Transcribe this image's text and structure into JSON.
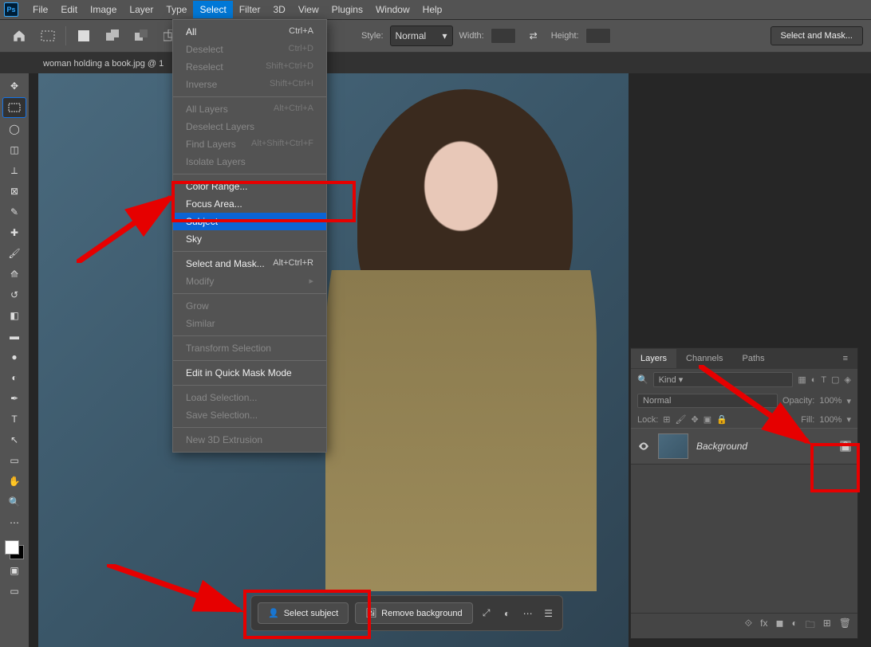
{
  "menubar": [
    "File",
    "Edit",
    "Image",
    "Layer",
    "Type",
    "Select",
    "Filter",
    "3D",
    "View",
    "Plugins",
    "Window",
    "Help"
  ],
  "active_menu": "Select",
  "tab": "woman holding a book.jpg @ 1",
  "optbar": {
    "style_label": "Style:",
    "style_value": "Normal",
    "width_label": "Width:",
    "height_label": "Height:",
    "mask_btn": "Select and Mask..."
  },
  "dropdown": {
    "groups": [
      [
        {
          "label": "All",
          "shortcut": "Ctrl+A",
          "enabled": true
        },
        {
          "label": "Deselect",
          "shortcut": "Ctrl+D",
          "enabled": false
        },
        {
          "label": "Reselect",
          "shortcut": "Shift+Ctrl+D",
          "enabled": false
        },
        {
          "label": "Inverse",
          "shortcut": "Shift+Ctrl+I",
          "enabled": false
        }
      ],
      [
        {
          "label": "All Layers",
          "shortcut": "Alt+Ctrl+A",
          "enabled": false
        },
        {
          "label": "Deselect Layers",
          "shortcut": "",
          "enabled": false
        },
        {
          "label": "Find Layers",
          "shortcut": "Alt+Shift+Ctrl+F",
          "enabled": false
        },
        {
          "label": "Isolate Layers",
          "shortcut": "",
          "enabled": false
        }
      ],
      [
        {
          "label": "Color Range...",
          "shortcut": "",
          "enabled": true
        },
        {
          "label": "Focus Area...",
          "shortcut": "",
          "enabled": true
        },
        {
          "label": "Subject",
          "shortcut": "",
          "enabled": true,
          "highlight": true
        },
        {
          "label": "Sky",
          "shortcut": "",
          "enabled": true
        }
      ],
      [
        {
          "label": "Select and Mask...",
          "shortcut": "Alt+Ctrl+R",
          "enabled": true
        },
        {
          "label": "Modify",
          "shortcut": "",
          "enabled": false,
          "submenu": true
        }
      ],
      [
        {
          "label": "Grow",
          "shortcut": "",
          "enabled": false
        },
        {
          "label": "Similar",
          "shortcut": "",
          "enabled": false
        }
      ],
      [
        {
          "label": "Transform Selection",
          "shortcut": "",
          "enabled": false
        }
      ],
      [
        {
          "label": "Edit in Quick Mask Mode",
          "shortcut": "",
          "enabled": true
        }
      ],
      [
        {
          "label": "Load Selection...",
          "shortcut": "",
          "enabled": false
        },
        {
          "label": "Save Selection...",
          "shortcut": "",
          "enabled": false
        }
      ],
      [
        {
          "label": "New 3D Extrusion",
          "shortcut": "",
          "enabled": false
        }
      ]
    ]
  },
  "layers": {
    "tabs": [
      "Layers",
      "Channels",
      "Paths"
    ],
    "kind_label": "Kind",
    "search_icon": "search",
    "blend": "Normal",
    "opacity_label": "Opacity:",
    "opacity_val": "100%",
    "lock_label": "Lock:",
    "fill_label": "Fill:",
    "fill_val": "100%",
    "layer0": {
      "name": "Background"
    }
  },
  "context": {
    "select_subject": "Select subject",
    "remove_background": "Remove background"
  },
  "colors": {
    "accent": "#0b64d4",
    "highlight_red": "#e60000"
  }
}
